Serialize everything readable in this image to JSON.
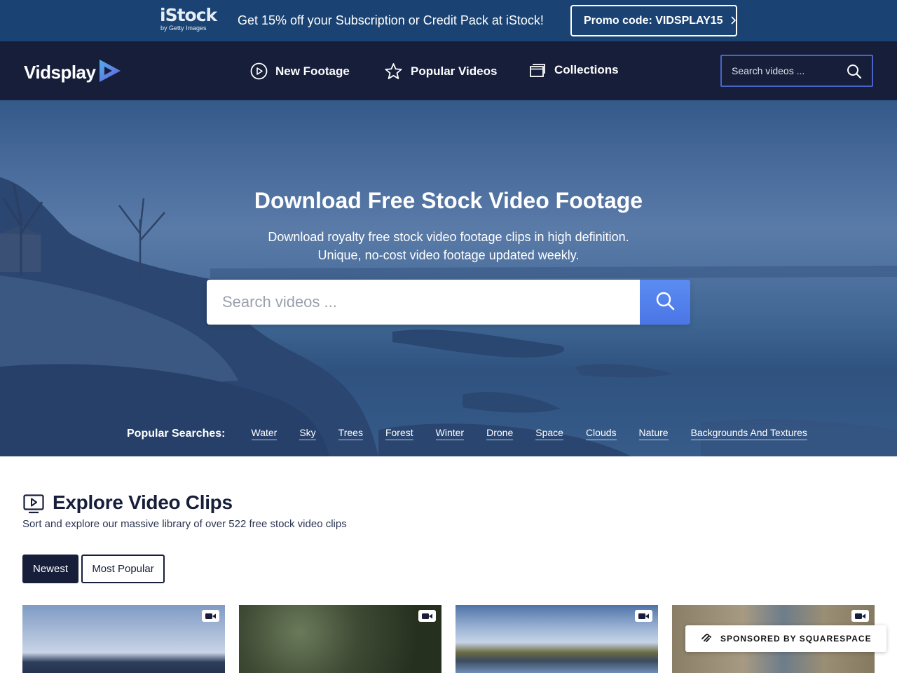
{
  "promo": {
    "brand_main": "iStock",
    "brand_sub": "by Getty Images",
    "text": "Get 15% off your Subscription or Credit Pack at iStock!",
    "button_label": "Promo code: VIDSPLAY15",
    "button_icon": "chevron-right-icon"
  },
  "header": {
    "logo_text": "Vidsplay",
    "logo_icon": "play-triangle-icon",
    "nav": [
      {
        "label": "New Footage",
        "icon": "play-circle-icon"
      },
      {
        "label": "Popular Videos",
        "icon": "star-icon"
      },
      {
        "label": "Collections",
        "icon": "collections-icon"
      }
    ],
    "search_placeholder": "Search videos ...",
    "search_icon": "search-icon"
  },
  "hero": {
    "title": "Download Free Stock Video Footage",
    "subtitle_line1": "Download royalty free stock video footage clips in high definition.",
    "subtitle_line2": "Unique, no-cost video footage updated weekly.",
    "search_placeholder": "Search videos ...",
    "popular_label": "Popular Searches:",
    "popular_searches": [
      "Water",
      "Sky",
      "Trees",
      "Forest",
      "Winter",
      "Drone",
      "Space",
      "Clouds",
      "Nature",
      "Backgrounds And Textures"
    ]
  },
  "explore": {
    "icon": "video-play-icon",
    "title": "Explore Video Clips",
    "subtitle": "Sort and explore our massive library of over 522 free stock video clips",
    "tabs": [
      "Newest",
      "Most Popular"
    ],
    "active_tab": "Newest"
  },
  "thumbnails": [
    {
      "icon": "video-camera-icon"
    },
    {
      "icon": "video-camera-icon"
    },
    {
      "icon": "video-camera-icon"
    },
    {
      "icon": "video-camera-icon"
    }
  ],
  "sponsor": {
    "text": "SPONSORED BY SQUARESPACE",
    "icon": "squarespace-icon"
  },
  "colors": {
    "promo_bg": "#1a4373",
    "header_bg": "#161e3a",
    "accent_blue": "#4b76e6",
    "search_border": "#4a63c7"
  }
}
